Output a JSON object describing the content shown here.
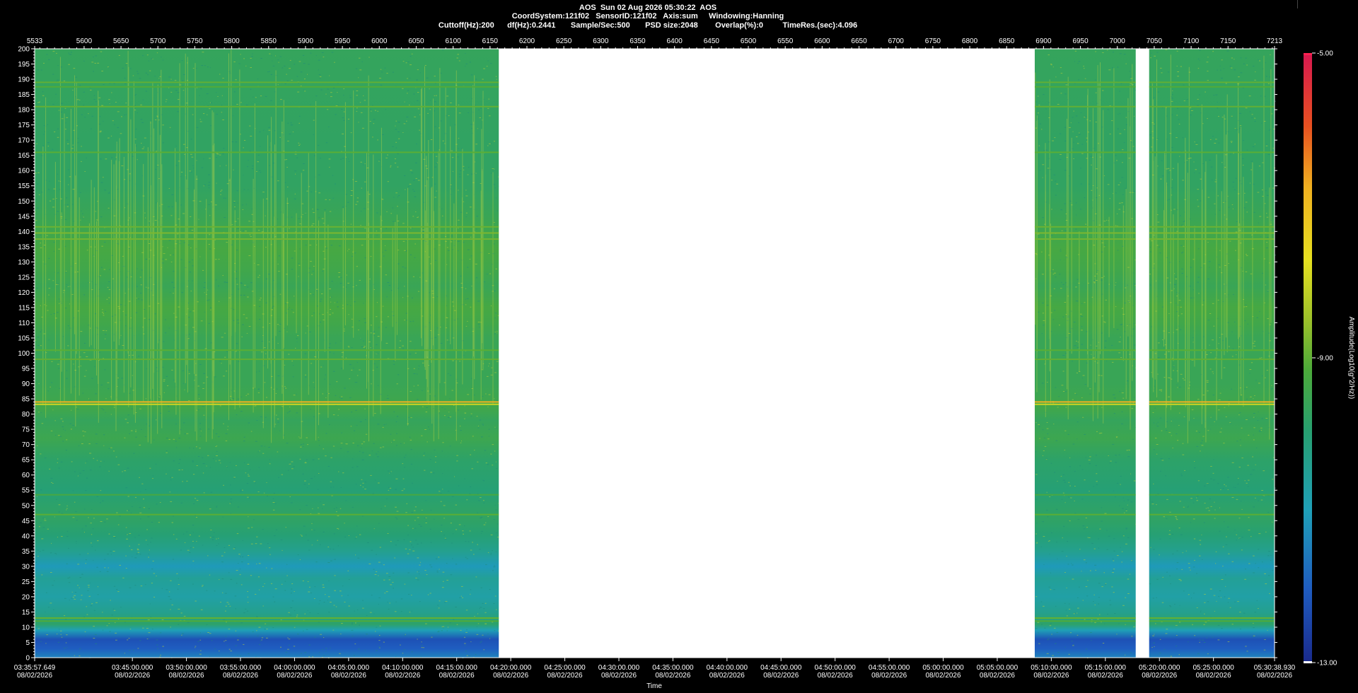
{
  "header": {
    "line1": "AOS  Sun 02 Aug 2026 05:30:22  AOS",
    "line2": "CoordSystem:121f02   SensorID:121f02   Axis:sum     Windowing:Hanning",
    "line3": "Cuttoff(Hz):200      df(Hz):0.2441       Sample/Sec:500       PSD size:2048        Overlap(%):0         TimeRes.(sec):4.096"
  },
  "chart_data": {
    "type": "heatmap",
    "title": "",
    "xlabel": "Time",
    "ylabel": "",
    "colorbar_label": "Amplitude(Log10(g^2/Hz))",
    "colorbar_ticks": [
      "-5.00",
      "-9.00",
      "-13.00"
    ],
    "colorbar_range": [
      -13,
      -5
    ],
    "colorscale": [
      "#1a2a8c",
      "#1f5cc0",
      "#1fa0b8",
      "#27a070",
      "#4caa3a",
      "#9ac02a",
      "#e6e020",
      "#f0b020",
      "#e85020",
      "#d81850"
    ],
    "y_range": [
      0,
      200
    ],
    "y_ticks": [
      "200",
      "195",
      "190",
      "185",
      "180",
      "175",
      "170",
      "165",
      "160",
      "155",
      "150",
      "145",
      "140",
      "135",
      "130",
      "125",
      "120",
      "115",
      "110",
      "105",
      "100",
      "95",
      "90",
      "85",
      "80",
      "75",
      "70",
      "65",
      "60",
      "55",
      "50",
      "45",
      "40",
      "35",
      "30",
      "25",
      "20",
      "15",
      "10",
      "5",
      "0"
    ],
    "x_frame_range": [
      5533,
      7213
    ],
    "x_top_ticks": [
      "5533",
      "5600",
      "5650",
      "5700",
      "5750",
      "5800",
      "5850",
      "5900",
      "5950",
      "6000",
      "6050",
      "6100",
      "6150",
      "6200",
      "6250",
      "6300",
      "6350",
      "6400",
      "6450",
      "6500",
      "6550",
      "6600",
      "6650",
      "6700",
      "6750",
      "6800",
      "6850",
      "6900",
      "6950",
      "7000",
      "7050",
      "7100",
      "7150",
      "7213"
    ],
    "x_time_ticks": [
      {
        "time": "03:35:57.649",
        "date": "08/02/2026"
      },
      {
        "time": "03:45:00.000",
        "date": "08/02/2026"
      },
      {
        "time": "03:50:00.000",
        "date": "08/02/2026"
      },
      {
        "time": "03:55:00.000",
        "date": "08/02/2026"
      },
      {
        "time": "04:00:00.000",
        "date": "08/02/2026"
      },
      {
        "time": "04:05:00.000",
        "date": "08/02/2026"
      },
      {
        "time": "04:10:00.000",
        "date": "08/02/2026"
      },
      {
        "time": "04:15:00.000",
        "date": "08/02/2026"
      },
      {
        "time": "04:20:00.000",
        "date": "08/02/2026"
      },
      {
        "time": "04:25:00.000",
        "date": "08/02/2026"
      },
      {
        "time": "04:30:00.000",
        "date": "08/02/2026"
      },
      {
        "time": "04:35:00.000",
        "date": "08/02/2026"
      },
      {
        "time": "04:40:00.000",
        "date": "08/02/2026"
      },
      {
        "time": "04:45:00.000",
        "date": "08/02/2026"
      },
      {
        "time": "04:50:00.000",
        "date": "08/02/2026"
      },
      {
        "time": "04:55:00.000",
        "date": "08/02/2026"
      },
      {
        "time": "05:00:00.000",
        "date": "08/02/2026"
      },
      {
        "time": "05:05:00.000",
        "date": "08/02/2026"
      },
      {
        "time": "05:10:00.000",
        "date": "08/02/2026"
      },
      {
        "time": "05:15:00.000",
        "date": "08/02/2026"
      },
      {
        "time": "05:20:00.000",
        "date": "08/02/2026"
      },
      {
        "time": "05:25:00.000",
        "date": "08/02/2026"
      },
      {
        "time": "05:30:38.930",
        "date": "08/02/2026"
      }
    ],
    "data_segments": [
      {
        "start_frame": 5533,
        "end_frame": 6162
      },
      {
        "start_frame": 6888,
        "end_frame": 7025
      },
      {
        "start_frame": 7043,
        "end_frame": 7213
      }
    ],
    "gaps": [
      {
        "start_frame": 6162,
        "end_frame": 6888
      },
      {
        "start_frame": 7025,
        "end_frame": 7043
      }
    ],
    "spectral_lines": [
      {
        "freq": 189.0,
        "level": -9.2
      },
      {
        "freq": 187.5,
        "level": -9.4
      },
      {
        "freq": 181.0,
        "level": -9.2
      },
      {
        "freq": 166.0,
        "level": -9.3
      },
      {
        "freq": 141.5,
        "level": -9.1
      },
      {
        "freq": 139.5,
        "level": -8.9
      },
      {
        "freq": 137.5,
        "level": -9.0
      },
      {
        "freq": 101.0,
        "level": -9.3
      },
      {
        "freq": 98.0,
        "level": -9.2
      },
      {
        "freq": 84.0,
        "level": -6.8
      },
      {
        "freq": 83.2,
        "level": -8.0
      },
      {
        "freq": 53.5,
        "level": -9.6
      },
      {
        "freq": 47.0,
        "level": -9.3
      },
      {
        "freq": 13.0,
        "level": -9.2
      },
      {
        "freq": 12.0,
        "level": -9.4
      }
    ],
    "broadband_profile": [
      {
        "freq": 0,
        "level": -11.6
      },
      {
        "freq": 3,
        "level": -12.1
      },
      {
        "freq": 6,
        "level": -12.3
      },
      {
        "freq": 9,
        "level": -11.2
      },
      {
        "freq": 11,
        "level": -10.2
      },
      {
        "freq": 15,
        "level": -10.7
      },
      {
        "freq": 20,
        "level": -11.0
      },
      {
        "freq": 26,
        "level": -10.8
      },
      {
        "freq": 30,
        "level": -11.3
      },
      {
        "freq": 35,
        "level": -10.7
      },
      {
        "freq": 40,
        "level": -10.4
      },
      {
        "freq": 46,
        "level": -10.1
      },
      {
        "freq": 55,
        "level": -10.4
      },
      {
        "freq": 65,
        "level": -10.2
      },
      {
        "freq": 72,
        "level": -9.8
      },
      {
        "freq": 78,
        "level": -10.0
      },
      {
        "freq": 82,
        "level": -9.7
      },
      {
        "freq": 90,
        "level": -9.9
      },
      {
        "freq": 105,
        "level": -9.9
      },
      {
        "freq": 110,
        "level": -9.7
      },
      {
        "freq": 115,
        "level": -9.6
      },
      {
        "freq": 122,
        "level": -9.9
      },
      {
        "freq": 128,
        "level": -9.7
      },
      {
        "freq": 134,
        "level": -9.6
      },
      {
        "freq": 145,
        "level": -9.9
      },
      {
        "freq": 155,
        "level": -10.1
      },
      {
        "freq": 170,
        "level": -10.1
      },
      {
        "freq": 200,
        "level": -10.0
      }
    ],
    "grid": false,
    "legend": "right"
  }
}
